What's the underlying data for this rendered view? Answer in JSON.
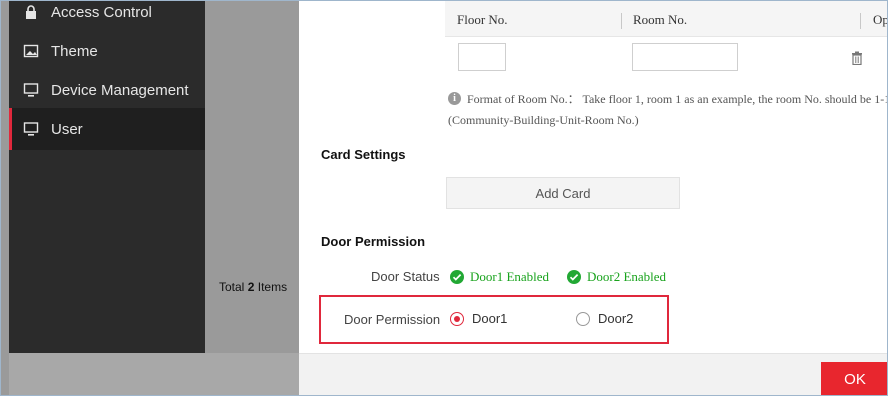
{
  "sidebar": {
    "items": [
      {
        "label": "Access Control",
        "icon": "lock-icon"
      },
      {
        "label": "Theme",
        "icon": "image-icon"
      },
      {
        "label": "Device Management",
        "icon": "monitor-icon"
      },
      {
        "label": "User",
        "icon": "monitor-icon",
        "active": true
      }
    ]
  },
  "list": {
    "total_prefix": "Total",
    "total_count": "2",
    "total_suffix": "Items"
  },
  "room_table": {
    "col_floor": "Floor No.",
    "col_room": "Room No.",
    "col_op": "Op",
    "floor_value": "",
    "room_value": ""
  },
  "info": {
    "line1": "Format of Room No.： Take floor 1, room 1 as an example, the room No. should be 1-1-1-",
    "line2": "(Community-Building-Unit-Room No.)"
  },
  "card_settings": {
    "title": "Card Settings",
    "add_label": "Add Card"
  },
  "door_permission": {
    "title": "Door Permission",
    "status_label": "Door Status",
    "status_items": [
      "Door1 Enabled",
      "Door2 Enabled"
    ],
    "permission_label": "Door Permission",
    "options": [
      {
        "label": "Door1",
        "checked": true
      },
      {
        "label": "Door2",
        "checked": false
      }
    ]
  },
  "footer": {
    "ok_label": "OK"
  },
  "colors": {
    "accent": "#e8262e",
    "enabled_green": "#19a31d",
    "sidebar_bg": "#2b2b2b"
  }
}
